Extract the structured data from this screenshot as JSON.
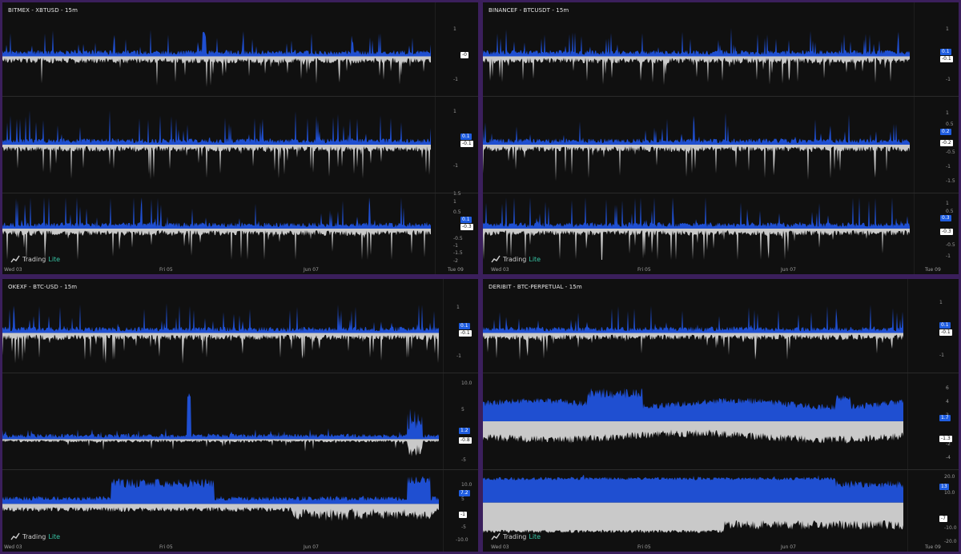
{
  "colors": {
    "frame": "#3b1f5c",
    "panel": "#101010",
    "buy": "#1f4fd1",
    "sell": "#c9c9c9",
    "logo_accent": "#37c6a5"
  },
  "logo": {
    "brand_a": "Trading",
    "brand_b": "Lite",
    "icon": "tradinglite-logo-icon"
  },
  "panels": [
    {
      "title": "BITMEX - XBTUSD - 15m",
      "x_labels": [
        "Wed 03",
        "Fri 05",
        "Jun 07",
        "Tue 09"
      ],
      "subs": [
        {
          "ticks": [
            "1",
            "-1"
          ],
          "badges": [
            {
              "text": "-0",
              "style": "white"
            }
          ]
        },
        {
          "ticks": [
            "1",
            "-1"
          ],
          "badges": [
            {
              "text": "0.1",
              "style": "blue"
            },
            {
              "text": "-0.1",
              "style": "white"
            }
          ]
        },
        {
          "ticks": [
            "1.5",
            "1",
            "0.5",
            "-0.5",
            "-1",
            "-1.5",
            "-2"
          ],
          "badges": [
            {
              "text": "0.1",
              "style": "blue"
            },
            {
              "text": "-0.3",
              "style": "white"
            }
          ]
        }
      ]
    },
    {
      "title": "BINANCEF - BTCUSDT - 15m",
      "x_labels": [
        "Wed 03",
        "Fri 05",
        "Jun 07",
        "Tue 09"
      ],
      "subs": [
        {
          "ticks": [
            "1",
            "-1"
          ],
          "badges": [
            {
              "text": "0.1",
              "style": "blue"
            },
            {
              "text": "-0.1",
              "style": "white"
            }
          ]
        },
        {
          "ticks": [
            "1",
            "0.5",
            "-0.5",
            "-1",
            "-1.5"
          ],
          "badges": [
            {
              "text": "0.2",
              "style": "blue"
            },
            {
              "text": "-0.2",
              "style": "white"
            }
          ]
        },
        {
          "ticks": [
            "1",
            "0.5",
            "-0.5",
            "-1"
          ],
          "badges": [
            {
              "text": "0.3",
              "style": "blue"
            },
            {
              "text": "-0.3",
              "style": "white"
            }
          ]
        }
      ]
    },
    {
      "title": "OKEXF - BTC-USD - 15m",
      "x_labels": [
        "Wed 03",
        "Fri 05",
        "Jun 07"
      ],
      "subs": [
        {
          "ticks": [
            "1",
            "-1"
          ],
          "badges": [
            {
              "text": "0.1",
              "style": "blue"
            },
            {
              "text": "-0.1",
              "style": "white"
            }
          ]
        },
        {
          "ticks": [
            "10.0",
            "5",
            "-5"
          ],
          "badges": [
            {
              "text": "1.2",
              "style": "blue"
            },
            {
              "text": "-0.8",
              "style": "white"
            }
          ]
        },
        {
          "ticks": [
            "10.0",
            "5",
            "-5",
            "-10.0"
          ],
          "badges": [
            {
              "text": "7.2",
              "style": "blue"
            },
            {
              "text": "-1",
              "style": "white"
            }
          ]
        }
      ]
    },
    {
      "title": "DERIBIT - BTC-PERPETUAL - 15m",
      "x_labels": [
        "Wed 03",
        "Fri 05",
        "Jun 07",
        "Tue 09"
      ],
      "subs": [
        {
          "ticks": [
            "1",
            "-1"
          ],
          "badges": [
            {
              "text": "0.1",
              "style": "blue"
            },
            {
              "text": "-0.1",
              "style": "white"
            }
          ]
        },
        {
          "ticks": [
            "6",
            "4",
            "2",
            "-2",
            "-4"
          ],
          "badges": [
            {
              "text": "1.7",
              "style": "blue"
            },
            {
              "text": "-1.3",
              "style": "white"
            }
          ]
        },
        {
          "ticks": [
            "20.0",
            "10.0",
            "-10.0",
            "-20.0"
          ],
          "badges": [
            {
              "text": "13",
              "style": "blue"
            },
            {
              "text": "-7",
              "style": "white"
            }
          ]
        }
      ]
    }
  ]
}
